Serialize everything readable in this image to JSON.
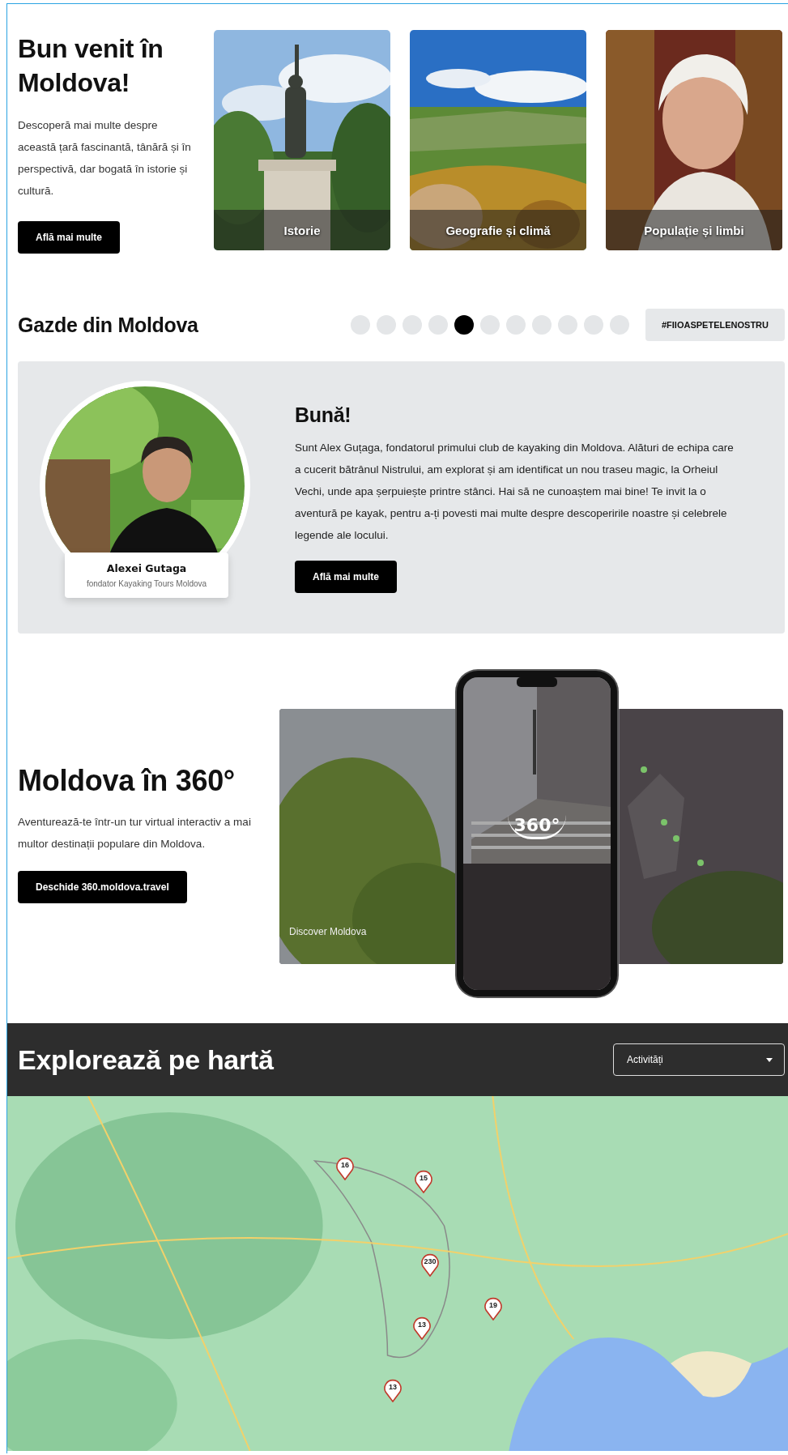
{
  "hero": {
    "title": "Bun venit în Moldova!",
    "text": "Descoperă mai multe despre această țară fascinantă, tânără și în perspectivă, dar bogată în istorie și cultură.",
    "button": "Află mai multe",
    "cards": [
      {
        "label": "Istorie",
        "kind": "picture"
      },
      {
        "label": "Geografie și climă",
        "kind": "picture"
      },
      {
        "label": "Populație și limbi",
        "kind": "picture"
      }
    ]
  },
  "hosts": {
    "title": "Gazde din Moldova",
    "dots": [
      {
        "selected": false
      },
      {
        "selected": false
      },
      {
        "selected": false
      },
      {
        "selected": false
      },
      {
        "selected": true
      },
      {
        "selected": false
      },
      {
        "selected": false
      },
      {
        "selected": false
      },
      {
        "selected": false
      },
      {
        "selected": false
      },
      {
        "selected": false
      }
    ],
    "hashtag": "#FIIOASPETELENOSTRU",
    "card": {
      "name": "Alexei Gutaga",
      "role": "fondator Kayaking Tours Moldova",
      "greeting": "Bună!",
      "text": "Sunt Alex Guțaga, fondatorul primului club de kayaking din Moldova. Alături de echipa care a cucerit bătrânul Nistrului, am explorat și am identificat un nou traseu magic, la Orheiul Vechi, unde apa șerpuiește printre stânci. Hai să ne cunoaștem mai bine! Te invit la o aventură pe kayak, pentru a-ți povesti mai multe despre descoperirile noastre și celebrele legende ale locului.",
      "button": "Află mai multe"
    }
  },
  "tour": {
    "title": "Moldova în 360°",
    "text": "Aventurează-te într-un tur virtual interactiv a mai multor destinații populare din Moldova.",
    "button": "Deschide 360.moldova.travel",
    "preview_caption": "Discover Moldova",
    "logo": "360°"
  },
  "map": {
    "title": "Explorează pe hartă",
    "select": {
      "value": "Activități"
    },
    "pins": [
      {
        "count": "16"
      },
      {
        "count": "15"
      },
      {
        "count": "230"
      },
      {
        "count": "19"
      },
      {
        "count": "13"
      },
      {
        "count": "13"
      }
    ]
  }
}
